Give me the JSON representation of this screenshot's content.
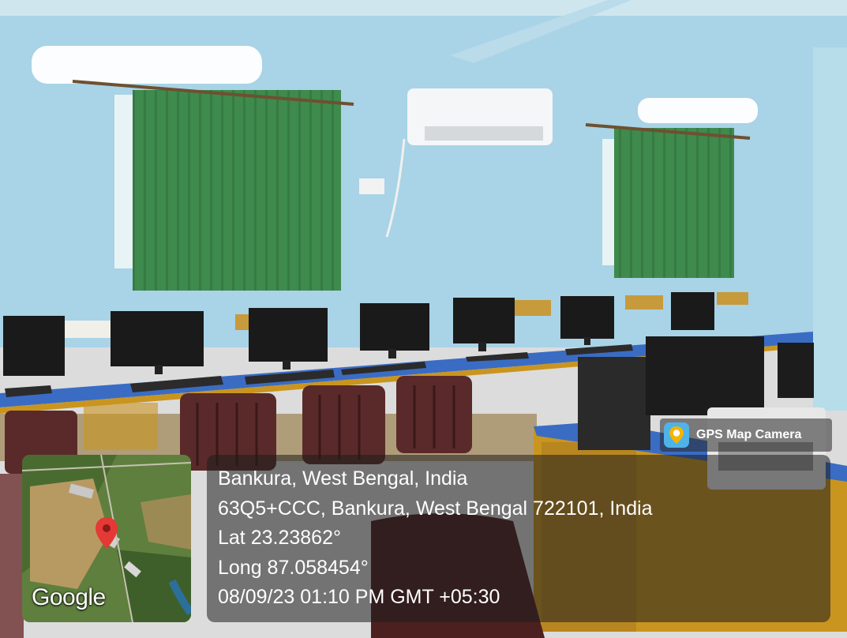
{
  "overlay": {
    "badge_label": "GPS Map Camera",
    "badge_icon": "map-pin-camera-icon",
    "map_watermark": "Google",
    "location_title": "Bankura, West Bengal, India",
    "address": "63Q5+CCC, Bankura, West Bengal 722101, India",
    "latitude": "Lat 23.23862°",
    "longitude": "Long 87.058454°",
    "datetime": "08/09/23 01:10 PM GMT +05:30"
  },
  "colors": {
    "wall": "#a9d3e6",
    "curtain": "#3f8a4d",
    "desk_top": "#3a6cc4",
    "desk_frame": "#c9951f",
    "chair": "#5a2a2a",
    "map_pin": "#e53935"
  }
}
